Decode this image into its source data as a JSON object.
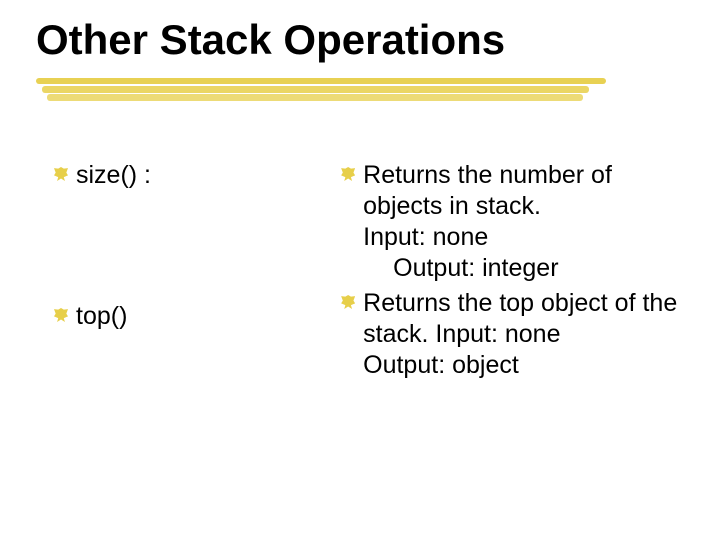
{
  "title": "Other Stack Operations",
  "left": {
    "item1": "size() :",
    "item2": "top()"
  },
  "right": {
    "item1_line1": "Returns the number of objects in stack.",
    "item1_line2": "Input: none",
    "item1_line3": "Output: integer",
    "item2_line1": "Returns the top object of the stack.  Input: none",
    "item2_line2": "Output: object"
  }
}
